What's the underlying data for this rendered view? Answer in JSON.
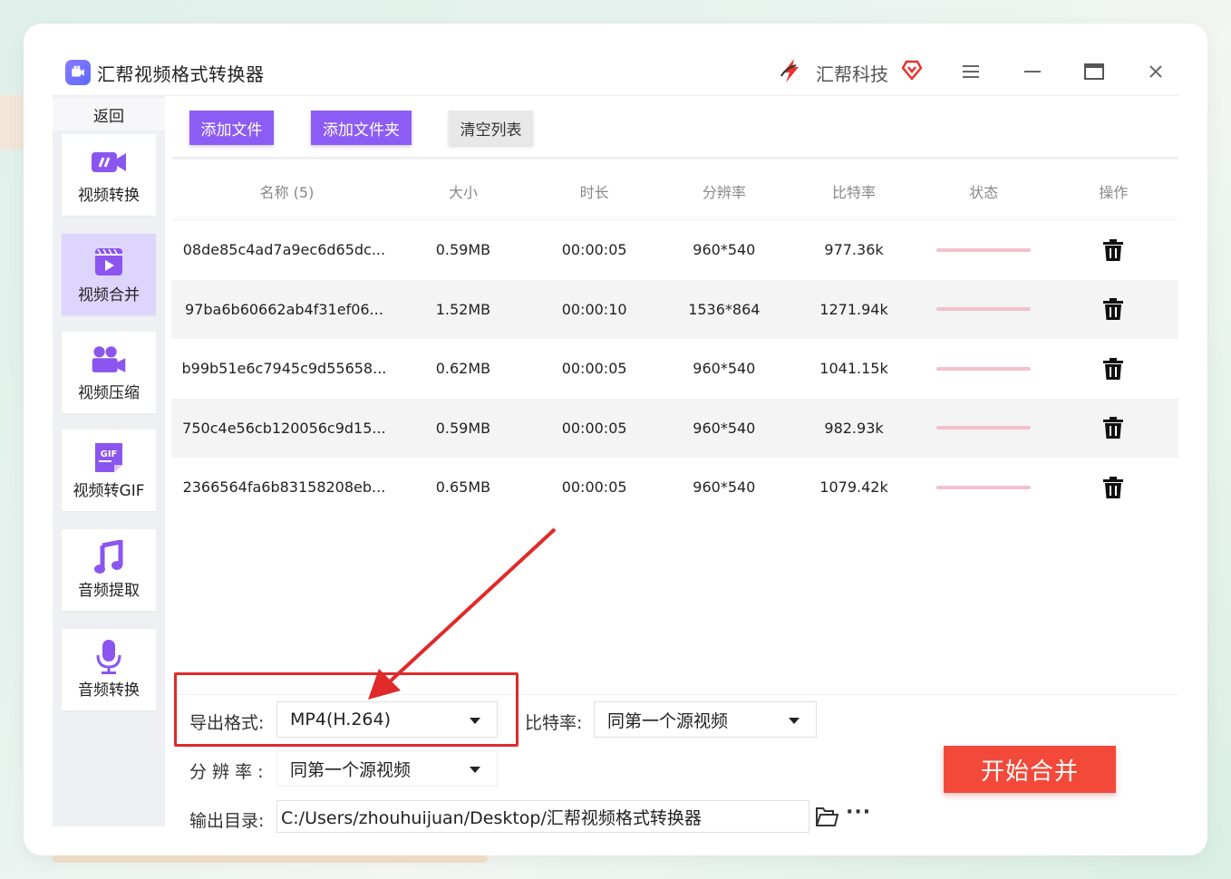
{
  "window": {
    "title": "汇帮视频格式转换器",
    "brand": "汇帮科技"
  },
  "sidebar": {
    "back_label": "返回",
    "items": [
      {
        "label": "视频转换",
        "icon": "video-convert-icon"
      },
      {
        "label": "视频合并",
        "icon": "video-merge-icon"
      },
      {
        "label": "视频压缩",
        "icon": "video-compress-icon"
      },
      {
        "label": "视频转GIF",
        "icon": "gif-icon"
      },
      {
        "label": "音频提取",
        "icon": "music-note-icon"
      },
      {
        "label": "音频转换",
        "icon": "microphone-icon"
      }
    ],
    "active_index": 1
  },
  "toolbar": {
    "add_file": "添加文件",
    "add_folder": "添加文件夹",
    "clear_list": "清空列表"
  },
  "table": {
    "headers": [
      "名称 (5)",
      "大小",
      "时长",
      "分辨率",
      "比特率",
      "状态",
      "操作"
    ],
    "rows": [
      {
        "name": "08de85c4ad7a9ec6d65dc...",
        "size": "0.59MB",
        "duration": "00:00:05",
        "resolution": "960*540",
        "bitrate": "977.36k"
      },
      {
        "name": "97ba6b60662ab4f31ef06...",
        "size": "1.52MB",
        "duration": "00:00:10",
        "resolution": "1536*864",
        "bitrate": "1271.94k"
      },
      {
        "name": "b99b51e6c7945c9d55658...",
        "size": "0.62MB",
        "duration": "00:00:05",
        "resolution": "960*540",
        "bitrate": "1041.15k"
      },
      {
        "name": "750c4e56cb120056c9d15...",
        "size": "0.59MB",
        "duration": "00:00:05",
        "resolution": "960*540",
        "bitrate": "982.93k"
      },
      {
        "name": "2366564fa6b83158208eb...",
        "size": "0.65MB",
        "duration": "00:00:05",
        "resolution": "960*540",
        "bitrate": "1079.42k"
      }
    ]
  },
  "settings": {
    "format_label": "导出格式:",
    "format_value": "MP4(H.264)",
    "bitrate_label": "比特率:",
    "bitrate_value": "同第一个源视频",
    "resolution_label": "分 辨 率 :",
    "resolution_value": "同第一个源视频",
    "output_label": "输出目录:",
    "output_path": "C:/Users/zhouhuijuan/Desktop/汇帮视频格式转换器",
    "more": "···"
  },
  "start_button": "开始合并",
  "colors": {
    "accent_purple": "#8c5cf5",
    "start_red": "#f3493a",
    "annotation_red": "#e02a2a",
    "progress_pink": "#f2c1cc"
  }
}
